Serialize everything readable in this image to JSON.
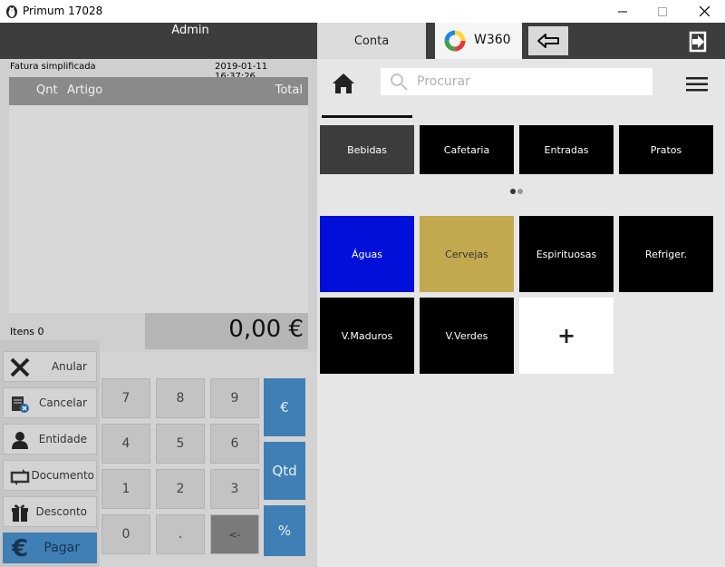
{
  "window": {
    "title": "Primum 17028"
  },
  "header": {
    "user": "Admin",
    "tab_conta": "Conta",
    "tab_w360": "W360"
  },
  "receipt": {
    "doc_type": "Fatura simplificada",
    "datetime": "2019-01-11 16:37:26",
    "columns": {
      "qnt": "Qnt",
      "artigo": "Artigo",
      "total": "Total"
    },
    "items_count": "Itens 0",
    "total": "0,00 €"
  },
  "actions": {
    "anular": "Anular",
    "cancelar": "Cancelar",
    "entidade": "Entidade",
    "documento": "Documento",
    "desconto": "Desconto",
    "pagar": "Pagar"
  },
  "keypad": {
    "k7": "7",
    "k8": "8",
    "k9": "9",
    "k4": "4",
    "k5": "5",
    "k6": "6",
    "k1": "1",
    "k2": "2",
    "k3": "3",
    "k0": "0",
    "dot": ".",
    "del": "<-",
    "euro": "€",
    "qtd": "Qtd",
    "percent": "%"
  },
  "search": {
    "placeholder": "Procurar"
  },
  "categories": [
    {
      "label": "Bebidas",
      "color": "#3c3c3c"
    },
    {
      "label": "Cafetaria",
      "color": "#000000"
    },
    {
      "label": "Entradas",
      "color": "#000000"
    },
    {
      "label": "Pratos",
      "color": "#000000"
    }
  ],
  "subcategories": [
    {
      "label": "Águas",
      "color": "#0010d8"
    },
    {
      "label": "Cervejas",
      "color": "#c2a84f",
      "text_color": "#333333"
    },
    {
      "label": "Espirituosas",
      "color": "#000000"
    },
    {
      "label": "Refriger.",
      "color": "#000000"
    },
    {
      "label": "V.Maduros",
      "color": "#000000"
    },
    {
      "label": "V.Verdes",
      "color": "#000000"
    }
  ],
  "add_tile": {
    "label": "+"
  },
  "colors": {
    "accent_blue": "#3f7fb5",
    "dark_bar": "#3d3d3d"
  }
}
